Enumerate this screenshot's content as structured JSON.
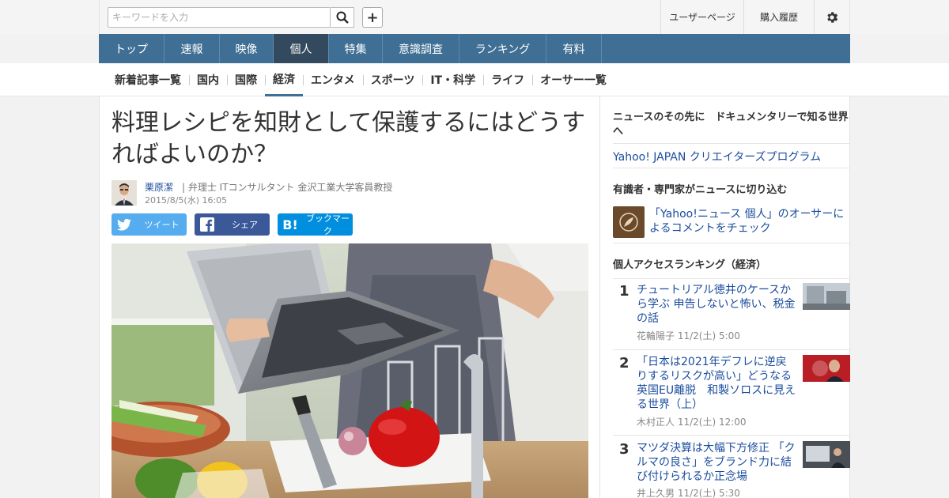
{
  "header": {
    "search_placeholder": "キーワードを入力",
    "user_page": "ユーザーページ",
    "purchase_history": "購入履歴"
  },
  "mainnav": [
    {
      "label": "トップ"
    },
    {
      "label": "速報"
    },
    {
      "label": "映像"
    },
    {
      "label": "個人"
    },
    {
      "label": "特集"
    },
    {
      "label": "意識調査"
    },
    {
      "label": "ランキング"
    },
    {
      "label": "有料"
    }
  ],
  "subnav": [
    {
      "label": "新着記事一覧"
    },
    {
      "label": "国内"
    },
    {
      "label": "国際"
    },
    {
      "label": "経済"
    },
    {
      "label": "エンタメ"
    },
    {
      "label": "スポーツ"
    },
    {
      "label": "IT・科学"
    },
    {
      "label": "ライフ"
    },
    {
      "label": "オーサー一覧"
    }
  ],
  "article": {
    "title": "料理レシピを知財として保護するにはどうすればよいのか？",
    "author_name": "栗原潔",
    "author_title": "| 弁理士 ITコンサルタント 金沢工業大学客員教授",
    "date": "2015/8/5(水) 16:05",
    "share_tweet": "ツイート",
    "share_facebook": "シェア",
    "share_hatena": "ブックマーク"
  },
  "sidebar": {
    "promo_heading": "ニュースのその先に　ドキュメンタリーで知る世界へ",
    "promo_link": "Yahoo! JAPAN クリエイターズプログラム",
    "experts_heading": "有識者・専門家がニュースに切り込む",
    "experts_link": "「Yahoo!ニュース 個人」のオーサーによるコメントをチェック",
    "ranking_heading": "個人アクセスランキング（経済）",
    "ranking": [
      {
        "rank": "1",
        "title": "チュートリアル徳井のケースから学ぶ 申告しないと怖い、税金の話",
        "meta": "花輪陽子 11/2(土) 5:00"
      },
      {
        "rank": "2",
        "title": "「日本は2021年デフレに逆戻りするリスクが高い」どうなる英国EU離脱　和製ソロスに見える世界（上）",
        "meta": "木村正人 11/2(土) 12:00"
      },
      {
        "rank": "3",
        "title": "マツダ決算は大幅下方修正 「クルマの良さ」をブランド力に結び付けられるか正念場",
        "meta": "井上久男 11/2(土) 5:30"
      }
    ]
  }
}
